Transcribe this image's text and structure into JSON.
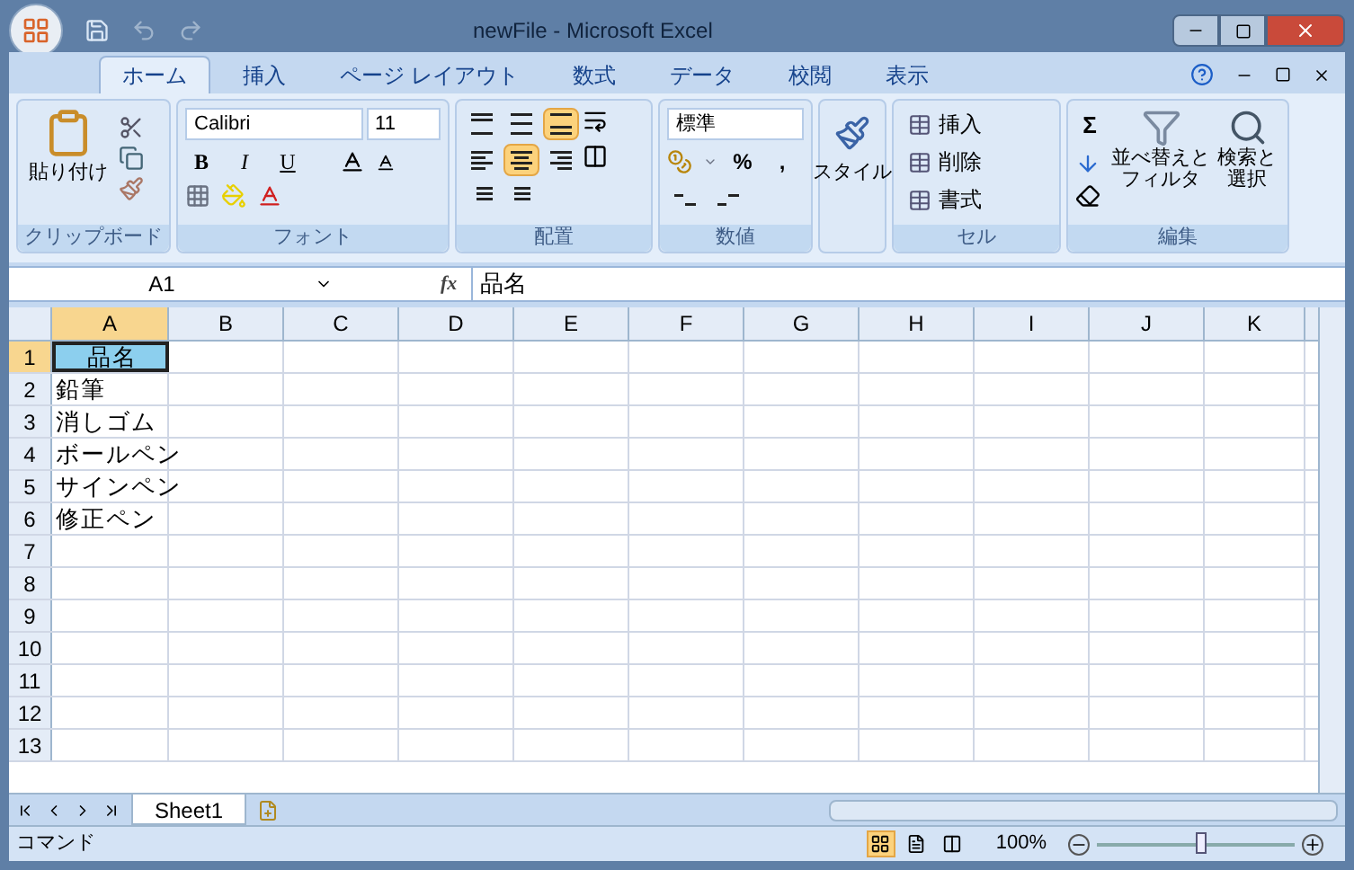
{
  "window": {
    "title": "newFile - Microsoft Excel"
  },
  "ribbon_tabs": [
    {
      "label": "ホーム",
      "selected": true
    },
    {
      "label": "挿入",
      "selected": false
    },
    {
      "label": "ページ レイアウト",
      "selected": false
    },
    {
      "label": "数式",
      "selected": false
    },
    {
      "label": "データ",
      "selected": false
    },
    {
      "label": "校閲",
      "selected": false
    },
    {
      "label": "表示",
      "selected": false
    }
  ],
  "groups": [
    {
      "kind": "clipboard",
      "label": "クリップボード",
      "paste": "貼り付け"
    },
    {
      "kind": "font",
      "label": "フォント",
      "font_name": "Calibri",
      "font_size": "11",
      "buttons": [
        "B",
        "I",
        "U"
      ]
    },
    {
      "kind": "alignment",
      "label": "配置",
      "vertical": [
        {
          "selected": false
        },
        {
          "selected": false
        },
        {
          "selected": true
        }
      ],
      "horizontal": [
        {
          "selected": false
        },
        {
          "selected": true
        },
        {
          "selected": false
        }
      ]
    },
    {
      "kind": "number",
      "label": "数値",
      "format": "標準",
      "buttons": [
        "%",
        ","
      ]
    },
    {
      "kind": "styles",
      "button": "スタイル"
    },
    {
      "kind": "cells",
      "label": "セル",
      "buttons": [
        "挿入",
        "削除",
        "書式"
      ]
    },
    {
      "kind": "editing",
      "label": "編集",
      "sum": "Σ",
      "buttons": [
        {
          "lines": [
            "並べ替えと",
            "フィルタ"
          ]
        },
        {
          "lines": [
            "検索と",
            "選択"
          ]
        }
      ]
    }
  ],
  "name_box": "A1",
  "fx": "fx",
  "formula": "品名",
  "columns": [
    {
      "label": "A",
      "selected": true
    },
    {
      "label": "B",
      "selected": false
    },
    {
      "label": "C",
      "selected": false
    },
    {
      "label": "D",
      "selected": false
    },
    {
      "label": "E",
      "selected": false
    },
    {
      "label": "F",
      "selected": false
    },
    {
      "label": "G",
      "selected": false
    },
    {
      "label": "H",
      "selected": false
    },
    {
      "label": "I",
      "selected": false
    },
    {
      "label": "J",
      "selected": false
    },
    {
      "label": "K",
      "selected": false
    }
  ],
  "rows": [
    {
      "number": "1",
      "selected": true,
      "cells": [
        {
          "text": "品名",
          "color": "#8ccfee",
          "active": true
        }
      ]
    },
    {
      "number": "2",
      "selected": false,
      "cells": [
        {
          "text": "鉛筆",
          "active": false
        }
      ]
    },
    {
      "number": "3",
      "selected": false,
      "cells": [
        {
          "text": "消しゴム",
          "active": false
        }
      ]
    },
    {
      "number": "4",
      "selected": false,
      "cells": [
        {
          "text": "ボールペン",
          "active": false
        }
      ]
    },
    {
      "number": "5",
      "selected": false,
      "cells": [
        {
          "text": "サインペン",
          "active": false
        }
      ]
    },
    {
      "number": "6",
      "selected": false,
      "cells": [
        {
          "text": "修正ペン",
          "active": false
        }
      ]
    },
    {
      "number": "7",
      "selected": false,
      "cells": []
    },
    {
      "number": "8",
      "selected": false,
      "cells": []
    },
    {
      "number": "9",
      "selected": false,
      "cells": []
    },
    {
      "number": "10",
      "selected": false,
      "cells": []
    },
    {
      "number": "11",
      "selected": false,
      "cells": []
    },
    {
      "number": "12",
      "selected": false,
      "cells": []
    },
    {
      "number": "13",
      "selected": false,
      "cells": []
    }
  ],
  "sheets": [
    {
      "label": "Sheet1",
      "selected": true
    }
  ],
  "status_bar": {
    "mode": "コマンド",
    "views": [
      {
        "selected": true
      },
      {
        "selected": false
      },
      {
        "selected": false
      }
    ],
    "zoom": "100%",
    "zoom_slider": {
      "level": 0.5
    }
  }
}
